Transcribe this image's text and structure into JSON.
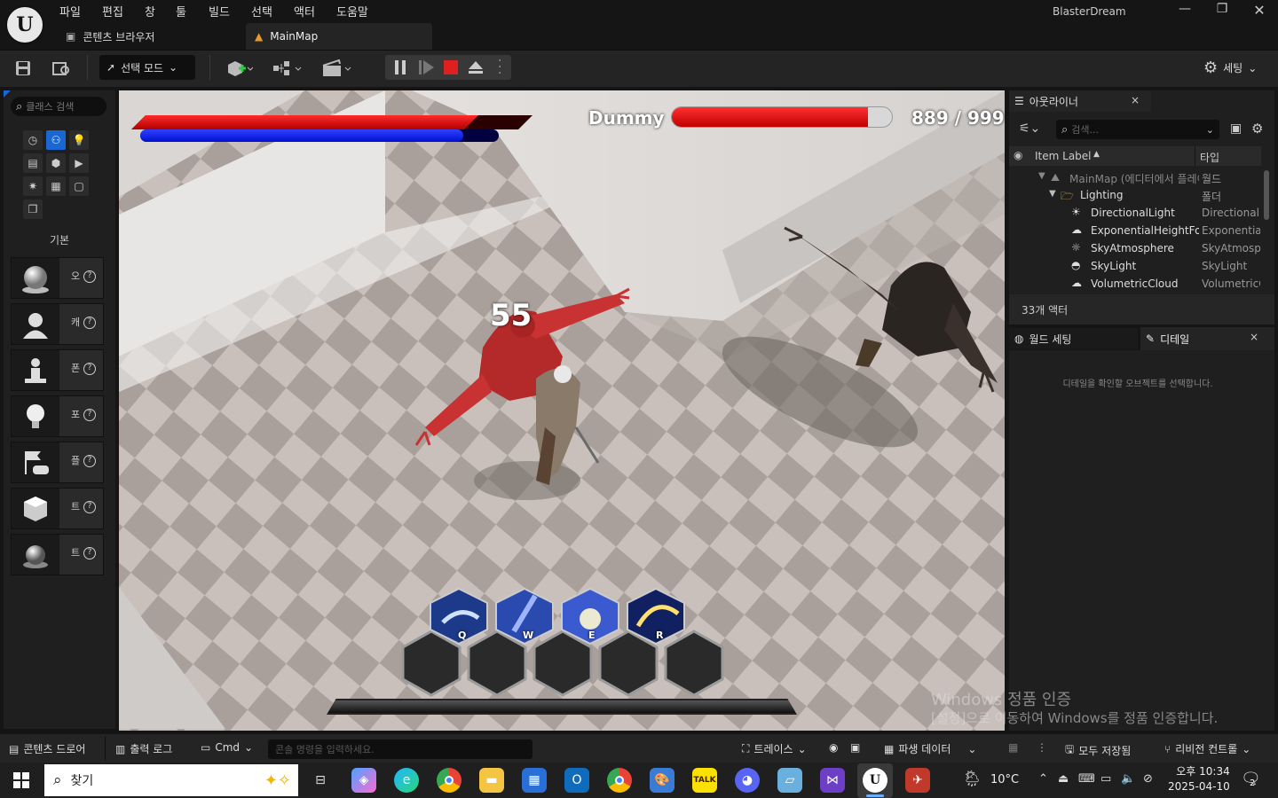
{
  "menu": [
    "파일",
    "편집",
    "창",
    "툴",
    "빌드",
    "선택",
    "액터",
    "도움말"
  ],
  "app_name": "BlasterDream",
  "window_controls": {
    "minimize": "—",
    "maximize": "❐",
    "close": "✕"
  },
  "tabs": {
    "content_browser": "콘텐츠 브라우저",
    "main_map": "MainMap"
  },
  "toolbar": {
    "mode": "선택 모드",
    "settings": "세팅"
  },
  "place_actors": {
    "search_placeholder": "클래스 검색",
    "category_label": "기본",
    "items": [
      {
        "label": "오"
      },
      {
        "label": "캐"
      },
      {
        "label": "폰"
      },
      {
        "label": "포"
      },
      {
        "label": "플"
      },
      {
        "label": "트"
      },
      {
        "label": "트"
      }
    ]
  },
  "hud": {
    "enemy_name": "Dummy",
    "hp_text": "889 / 999",
    "damage_number": "55",
    "player_hp": 0.86,
    "player_mana": 0.9,
    "enemy_hp": 0.89,
    "skills": [
      {
        "key": "Q"
      },
      {
        "key": "W"
      },
      {
        "key": "E"
      },
      {
        "key": "R"
      }
    ]
  },
  "outliner": {
    "title": "아웃라이너",
    "search_placeholder": "검색...",
    "col_label": "Item Label",
    "col_type": "타입",
    "rows": [
      {
        "name": "MainMap (에디터에서 플레이)",
        "type": "월드",
        "dim": true
      },
      {
        "name": "Lighting",
        "type": "폴더"
      },
      {
        "name": "DirectionalLight",
        "type": "DirectionalLight"
      },
      {
        "name": "ExponentialHeightFog",
        "type": "ExponentialHeightFog"
      },
      {
        "name": "SkyAtmosphere",
        "type": "SkyAtmosphere"
      },
      {
        "name": "SkyLight",
        "type": "SkyLight"
      },
      {
        "name": "VolumetricCloud",
        "type": "VolumetricCloud"
      }
    ],
    "count": "33개 액터"
  },
  "details": {
    "tab_world": "월드 세팅",
    "tab_details": "디테일",
    "empty_message": "디테일을 확인할 오브젝트를 선택합니다."
  },
  "bottom": {
    "content_drawer": "콘텐츠 드로어",
    "output_log": "출력 로그",
    "cmd": "Cmd",
    "cmd_placeholder": "콘솔 명령을 입력하세요.",
    "trace": "트레이스",
    "derived_data": "파생 데이터",
    "save_all": "모두 저장됨",
    "revision": "리비전 컨트롤"
  },
  "watermark": {
    "line1": "Windows 정품 인증",
    "line2": "[설정]으로 이동하여 Windows를 정품 인증합니다."
  },
  "taskbar": {
    "search": "찾기",
    "temperature": "10°C",
    "time": "오후 10:34",
    "date": "2025-04-10",
    "notif_count": "2"
  },
  "colors": {
    "accent": "#1a66d2",
    "hp_red": "#d40000",
    "mana_blue": "#0018ff",
    "stop_red": "#e02020"
  }
}
